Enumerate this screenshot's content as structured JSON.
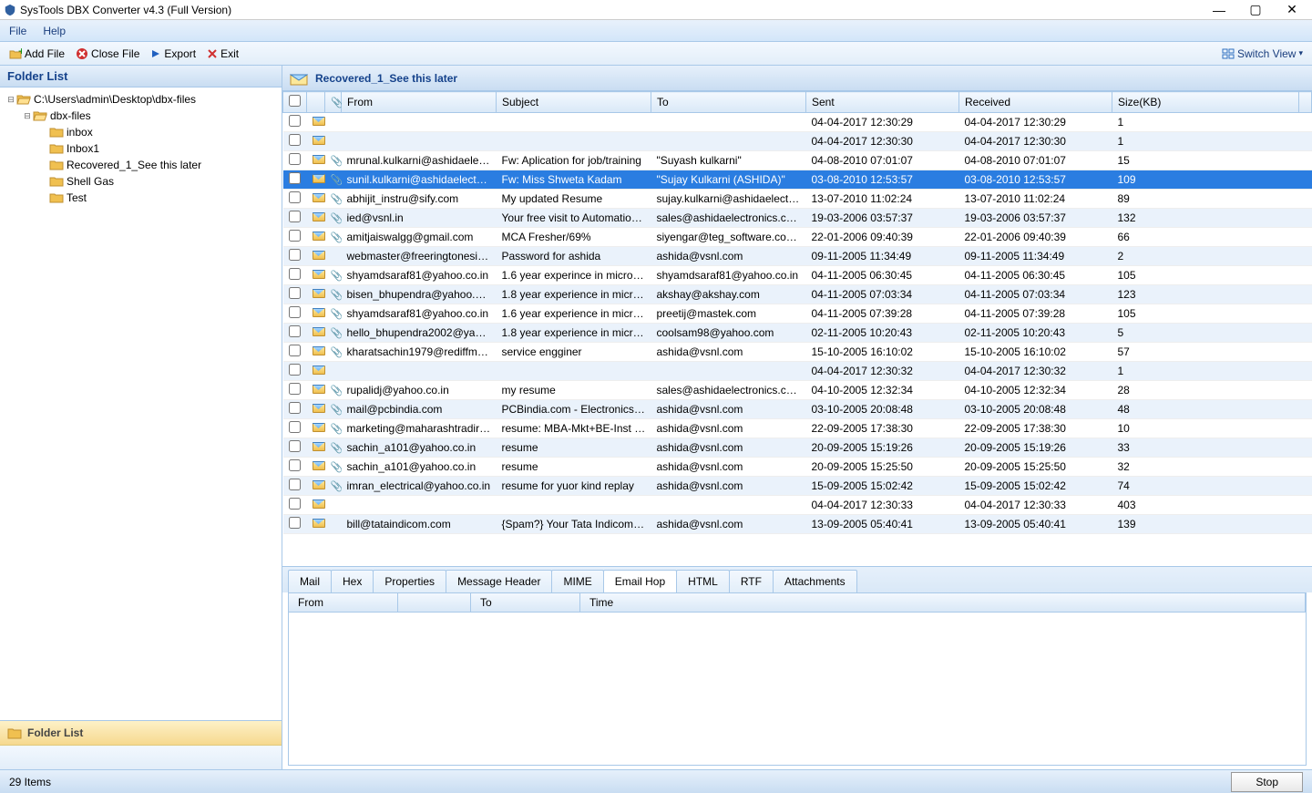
{
  "title": "SysTools DBX Converter v4.3 (Full Version)",
  "menu": {
    "file": "File",
    "help": "Help"
  },
  "toolbar": {
    "add_file": "Add File",
    "close_file": "Close File",
    "export": "Export",
    "exit": "Exit",
    "switch_view": "Switch View"
  },
  "sidebar": {
    "title": "Folder List",
    "tree": [
      {
        "level": 0,
        "expander": "⊟",
        "label": "C:\\Users\\admin\\Desktop\\dbx-files",
        "open": true
      },
      {
        "level": 1,
        "expander": "⊟",
        "label": "dbx-files",
        "open": true
      },
      {
        "level": 2,
        "expander": "",
        "label": "inbox"
      },
      {
        "level": 2,
        "expander": "",
        "label": "Inbox1"
      },
      {
        "level": 2,
        "expander": "",
        "label": "Recovered_1_See this later"
      },
      {
        "level": 2,
        "expander": "",
        "label": "Shell Gas"
      },
      {
        "level": 2,
        "expander": "",
        "label": "Test"
      }
    ],
    "nav_button": "Folder List"
  },
  "main": {
    "title": "Recovered_1_See this later",
    "columns": {
      "from": "From",
      "subject": "Subject",
      "to": "To",
      "sent": "Sent",
      "received": "Received",
      "size": "Size(KB)"
    },
    "rows": [
      {
        "att": "",
        "from": "",
        "subject": "",
        "to": "",
        "sent": "04-04-2017 12:30:29",
        "received": "04-04-2017 12:30:29",
        "size": "1",
        "selected": false
      },
      {
        "att": "",
        "from": "",
        "subject": "",
        "to": "",
        "sent": "04-04-2017 12:30:30",
        "received": "04-04-2017 12:30:30",
        "size": "1",
        "selected": false
      },
      {
        "att": "📎",
        "from": "mrunal.kulkarni@ashidaelectr...",
        "subject": "Fw: Aplication for job/training",
        "to": "\"Suyash kulkarni\" <suyash.kul...",
        "sent": "04-08-2010 07:01:07",
        "received": "04-08-2010 07:01:07",
        "size": "15",
        "selected": false
      },
      {
        "att": "📎",
        "from": "sunil.kulkarni@ashidaelectron...",
        "subject": "Fw: Miss Shweta Kadam",
        "to": "\"Sujay Kulkarni (ASHIDA)\" <suj...",
        "sent": "03-08-2010 12:53:57",
        "received": "03-08-2010 12:53:57",
        "size": "109",
        "selected": true
      },
      {
        "att": "📎",
        "from": "abhijit_instru@sify.com",
        "subject": "My updated Resume",
        "to": "sujay.kulkarni@ashidaelectron...",
        "sent": "13-07-2010 11:02:24",
        "received": "13-07-2010 11:02:24",
        "size": "89",
        "selected": false
      },
      {
        "att": "📎",
        "from": "ied@vsnl.in",
        "subject": "Your free visit to Automation 2...",
        "to": "sales@ashidaelectronics.com",
        "sent": "19-03-2006 03:57:37",
        "received": "19-03-2006 03:57:37",
        "size": "132",
        "selected": false
      },
      {
        "att": "📎",
        "from": "amitjaiswalgg@gmail.com",
        "subject": "MCA Fresher/69%",
        "to": "siyengar@teg_software.com, b...",
        "sent": "22-01-2006 09:40:39",
        "received": "22-01-2006 09:40:39",
        "size": "66",
        "selected": false
      },
      {
        "att": "",
        "from": "webmaster@freeringtonesindi...",
        "subject": "Password for ashida",
        "to": "ashida@vsnl.com",
        "sent": "09-11-2005 11:34:49",
        "received": "09-11-2005 11:34:49",
        "size": "2",
        "selected": false
      },
      {
        "att": "📎",
        "from": "shyamdsaraf81@yahoo.co.in",
        "subject": "1.6 year experince in microsoft...",
        "to": "shyamdsaraf81@yahoo.co.in",
        "sent": "04-11-2005 06:30:45",
        "received": "04-11-2005 06:30:45",
        "size": "105",
        "selected": false
      },
      {
        "att": "📎",
        "from": "bisen_bhupendra@yahoo.co.in",
        "subject": "1.8 year experience in microsof...",
        "to": "akshay@akshay.com",
        "sent": "04-11-2005 07:03:34",
        "received": "04-11-2005 07:03:34",
        "size": "123",
        "selected": false
      },
      {
        "att": "📎",
        "from": "shyamdsaraf81@yahoo.co.in",
        "subject": "1.6 year experience in microsof...",
        "to": "preetij@mastek.com",
        "sent": "04-11-2005 07:39:28",
        "received": "04-11-2005 07:39:28",
        "size": "105",
        "selected": false
      },
      {
        "att": "📎",
        "from": "hello_bhupendra2002@yahoo....",
        "subject": "1.8 year experience in microsof...",
        "to": "coolsam98@yahoo.com",
        "sent": "02-11-2005 10:20:43",
        "received": "02-11-2005 10:20:43",
        "size": "5",
        "selected": false
      },
      {
        "att": "📎",
        "from": "kharatsachin1979@rediffmail....",
        "subject": "service engginer",
        "to": "ashida@vsnl.com",
        "sent": "15-10-2005 16:10:02",
        "received": "15-10-2005 16:10:02",
        "size": "57",
        "selected": false
      },
      {
        "att": "",
        "from": "",
        "subject": "",
        "to": "",
        "sent": "04-04-2017 12:30:32",
        "received": "04-04-2017 12:30:32",
        "size": "1",
        "selected": false
      },
      {
        "att": "📎",
        "from": "rupalidj@yahoo.co.in",
        "subject": "my resume",
        "to": "sales@ashidaelectronics.com",
        "sent": "04-10-2005 12:32:34",
        "received": "04-10-2005 12:32:34",
        "size": "28",
        "selected": false
      },
      {
        "att": "📎",
        "from": "mail@pcbindia.com",
        "subject": "PCBindia.com - Electronics Sou...",
        "to": "ashida@vsnl.com",
        "sent": "03-10-2005 20:08:48",
        "received": "03-10-2005 20:08:48",
        "size": "48",
        "selected": false
      },
      {
        "att": "📎",
        "from": "marketing@maharashtradirect...",
        "subject": "resume: MBA-Mkt+BE-Inst & C...",
        "to": "ashida@vsnl.com",
        "sent": "22-09-2005 17:38:30",
        "received": "22-09-2005 17:38:30",
        "size": "10",
        "selected": false
      },
      {
        "att": "📎",
        "from": "sachin_a101@yahoo.co.in",
        "subject": "resume",
        "to": "ashida@vsnl.com",
        "sent": "20-09-2005 15:19:26",
        "received": "20-09-2005 15:19:26",
        "size": "33",
        "selected": false
      },
      {
        "att": "📎",
        "from": "sachin_a101@yahoo.co.in",
        "subject": "resume",
        "to": "ashida@vsnl.com",
        "sent": "20-09-2005 15:25:50",
        "received": "20-09-2005 15:25:50",
        "size": "32",
        "selected": false
      },
      {
        "att": "📎",
        "from": "imran_electrical@yahoo.co.in",
        "subject": "resume for yuor kind replay",
        "to": "ashida@vsnl.com",
        "sent": "15-09-2005 15:02:42",
        "received": "15-09-2005 15:02:42",
        "size": "74",
        "selected": false
      },
      {
        "att": "",
        "from": "",
        "subject": "",
        "to": "",
        "sent": "04-04-2017 12:30:33",
        "received": "04-04-2017 12:30:33",
        "size": "403",
        "selected": false
      },
      {
        "att": "",
        "from": "bill@tataindicom.com",
        "subject": "{Spam?} Your Tata Indicom Bill ...",
        "to": "ashida@vsnl.com",
        "sent": "13-09-2005 05:40:41",
        "received": "13-09-2005 05:40:41",
        "size": "139",
        "selected": false
      }
    ]
  },
  "tabs": [
    "Mail",
    "Hex",
    "Properties",
    "Message Header",
    "MIME",
    "Email Hop",
    "HTML",
    "RTF",
    "Attachments"
  ],
  "active_tab": 5,
  "preview_headers": {
    "from": "From",
    "to": "To",
    "time": "Time"
  },
  "status": {
    "items": "29 Items",
    "stop": "Stop"
  }
}
